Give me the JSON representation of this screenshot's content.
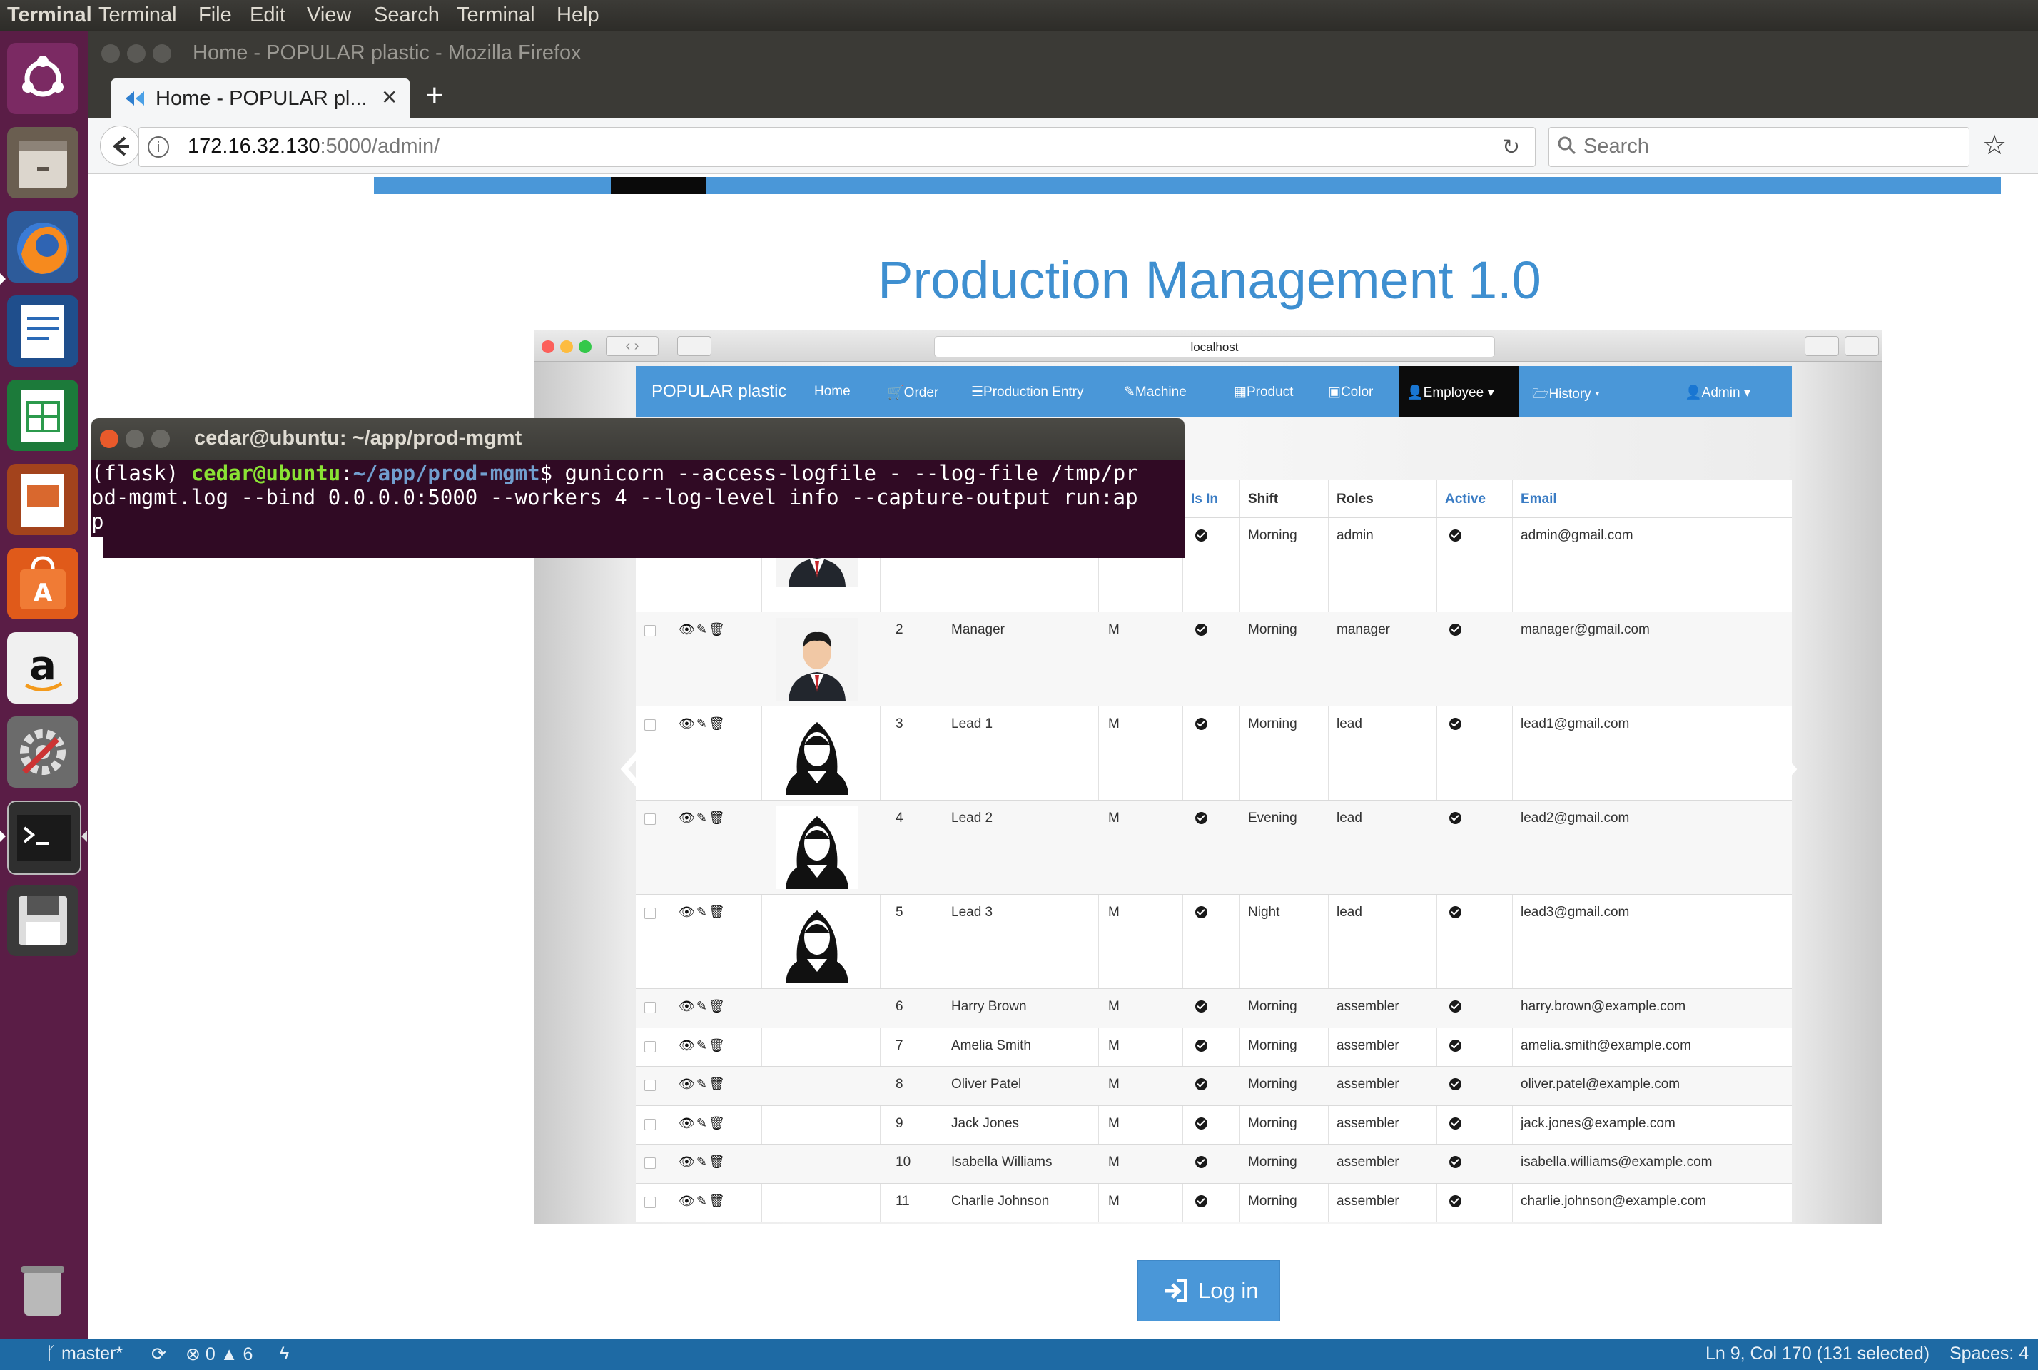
{
  "topbar": {
    "active_app": "Terminal",
    "menus": [
      "Terminal",
      "File",
      "Edit",
      "View",
      "Search",
      "Terminal",
      "Help"
    ]
  },
  "launcher": {
    "icons": [
      "ubuntu-dash-icon",
      "files-icon",
      "firefox-icon",
      "writer-icon",
      "calc-icon",
      "impress-icon",
      "software-center-icon",
      "amazon-icon",
      "system-settings-icon",
      "terminal-icon",
      "floppy-icon",
      "trash-icon"
    ]
  },
  "browser": {
    "window_title": "Home - POPULAR plastic - Mozilla Firefox",
    "tab_label": "Home - POPULAR pl...",
    "url_host": "172.16.32.130",
    "url_rest": ":5000/admin/",
    "search_placeholder": "Search"
  },
  "page": {
    "title": "Production Management 1.0",
    "login_label": "Log in"
  },
  "inner_screenshot": {
    "safari_url": "localhost",
    "nav": {
      "brand": "POPULAR plastic",
      "items": [
        "Home",
        "Order",
        "Production Entry",
        "Machine",
        "Product",
        "Color",
        "Employee",
        "History",
        "Admin"
      ]
    },
    "table": {
      "headers": [
        "Is In",
        "Shift",
        "Roles",
        "Active",
        "Email"
      ],
      "rows": [
        {
          "id": "",
          "name": "",
          "gender": "",
          "shift": "Morning",
          "role": "admin",
          "email": "admin@gmail.com"
        },
        {
          "id": "2",
          "name": "Manager",
          "gender": "M",
          "shift": "Morning",
          "role": "manager",
          "email": "manager@gmail.com"
        },
        {
          "id": "3",
          "name": "Lead 1",
          "gender": "M",
          "shift": "Morning",
          "role": "lead",
          "email": "lead1@gmail.com"
        },
        {
          "id": "4",
          "name": "Lead 2",
          "gender": "M",
          "shift": "Evening",
          "role": "lead",
          "email": "lead2@gmail.com"
        },
        {
          "id": "5",
          "name": "Lead 3",
          "gender": "M",
          "shift": "Night",
          "role": "lead",
          "email": "lead3@gmail.com"
        },
        {
          "id": "6",
          "name": "Harry Brown",
          "gender": "M",
          "shift": "Morning",
          "role": "assembler",
          "email": "harry.brown@example.com"
        },
        {
          "id": "7",
          "name": "Amelia Smith",
          "gender": "M",
          "shift": "Morning",
          "role": "assembler",
          "email": "amelia.smith@example.com"
        },
        {
          "id": "8",
          "name": "Oliver Patel",
          "gender": "M",
          "shift": "Morning",
          "role": "assembler",
          "email": "oliver.patel@example.com"
        },
        {
          "id": "9",
          "name": "Jack Jones",
          "gender": "M",
          "shift": "Morning",
          "role": "assembler",
          "email": "jack.jones@example.com"
        },
        {
          "id": "10",
          "name": "Isabella Williams",
          "gender": "M",
          "shift": "Morning",
          "role": "assembler",
          "email": "isabella.williams@example.com"
        },
        {
          "id": "11",
          "name": "Charlie Johnson",
          "gender": "M",
          "shift": "Morning",
          "role": "assembler",
          "email": "charlie.johnson@example.com"
        }
      ]
    }
  },
  "terminal": {
    "title": "cedar@ubuntu: ~/app/prod-mgmt",
    "prompt_env": "(flask) ",
    "prompt_user": "cedar@ubuntu",
    "prompt_path": "~/app/prod-mgmt",
    "line1_cmd": "$ gunicorn --access-logfile - --log-file /tmp/pr",
    "line2": "od-mgmt.log --bind 0.0.0.0:5000 --workers 4 --log-level info --capture-output run:ap",
    "line3": "p"
  },
  "statusbar": {
    "branch": "master*",
    "errors": "0",
    "warnings": "6",
    "position": "Ln 9, Col 170 (131 selected)",
    "indent": "Spaces: 4"
  },
  "colors": {
    "accent_blue": "#4a97d8",
    "launcher": "#5a1d46",
    "terminal_bg": "#300a24",
    "status_bar": "#1e6aa4"
  }
}
